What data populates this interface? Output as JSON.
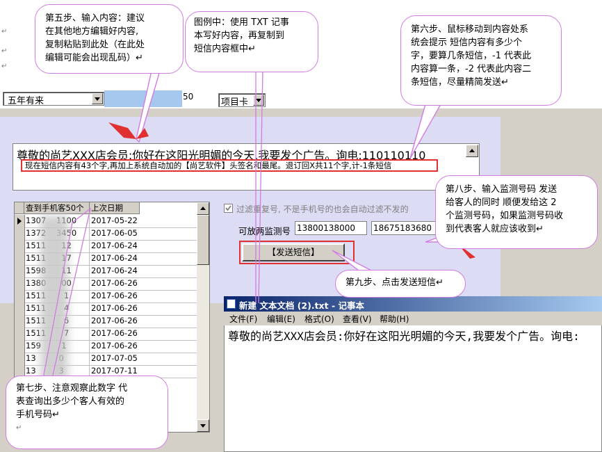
{
  "margin_marks": [
    "↵",
    "↵",
    "↵"
  ],
  "toolbar": {
    "combo_value": "五年有来",
    "number_label": "50",
    "card_combo_value": "项目卡"
  },
  "message": {
    "content": "尊敬的尚艺XXX店会员:你好在这阳光明媚的今天,我要发个广告。询电:110110110",
    "info": "现在短信内容有43个字,再加上系统自动加的【尚艺软件】头签名和最尾。退订回X共11个字,计-1条短信"
  },
  "grid": {
    "headers": [
      "查到手机客50个",
      "上次日期"
    ],
    "rows": [
      {
        "phone": "1307    1100",
        "date": "2017-05-22"
      },
      {
        "phone": "1372    3450",
        "date": "2017-06-05"
      },
      {
        "phone": "1511      12",
        "date": "2017-06-24"
      },
      {
        "phone": "1511      17",
        "date": "2017-06-24"
      },
      {
        "phone": "1598      11",
        "date": "2017-06-24"
      },
      {
        "phone": "1380      00",
        "date": "2017-06-26"
      },
      {
        "phone": "1511       1",
        "date": "2017-06-26"
      },
      {
        "phone": "1511       4",
        "date": "2017-06-26"
      },
      {
        "phone": "1511       6",
        "date": "2017-06-26"
      },
      {
        "phone": "1511       7",
        "date": "2017-06-26"
      },
      {
        "phone": "159        1",
        "date": "2017-06-26"
      },
      {
        "phone": "13         0",
        "date": "2017-07-05"
      },
      {
        "phone": "13         3",
        "date": "2017-07-11"
      }
    ]
  },
  "filter": {
    "checkbox_label": "过滤重复号, 不是手机号的也会自动过滤不发的"
  },
  "monitor": {
    "label": "可放两监测号",
    "number1": "13800138000",
    "number2": "18675183680"
  },
  "send_button_label": "【发送短信】",
  "notepad": {
    "title": "新建 文本文档 (2).txt - 记事本",
    "menu": [
      "文件(F)",
      "编辑(E)",
      "格式(O)",
      "查看(V)",
      "帮助(H)"
    ],
    "content": "尊敬的尚艺XXX店会员:你好在这阳光明媚的今天,我要发个广告。询电:"
  },
  "callouts": {
    "step5": [
      "第五步、输入内容：建议",
      "在其他地方编辑好内容,",
      "复制粘贴到此处（在此处",
      "编辑可能会出现乱码）↵"
    ],
    "example": [
      "图例中：使用 TXT 记事",
      "本写好内容，再复制到",
      "短信内容框中↵"
    ],
    "step6": [
      "第六步、鼠标移动到内容处系",
      "统会提示  短信内容有多少个",
      "字，要算几条短信，-1  代表此",
      "内容算一条，-2  代表此内容二",
      "条短信，尽量精简发送↵"
    ],
    "step7": [
      "第七步、注意观察此数字  代",
      "表查询出多少个客人有效的",
      "手机号码↵",
      "↵"
    ],
    "step8": [
      "第八步、输入监测号码  发送",
      "给客人的同时  顺便发给这  2",
      "个监测号码，如果监测号码收",
      "到代表客人就应该收到↵"
    ],
    "step9": "第九步、点击发送短信↵"
  },
  "colors": {
    "callout_border": "#d27be2",
    "highlight_red": "#e03030",
    "notepad_title_start": "#0a246a",
    "field_blue": "#a6c7ee"
  }
}
